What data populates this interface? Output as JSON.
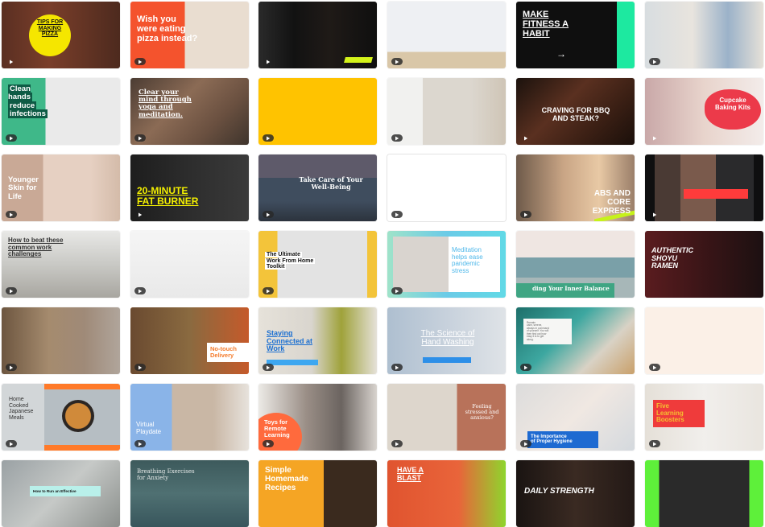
{
  "gallery": {
    "items": [
      {
        "id": "tips-pizza",
        "lines": "TIPS FOR\nMAKING\nPIZZA",
        "bg": "linear-gradient(90deg,#5a2f22,#7a3e2a 40%,#4d2a1e)",
        "accent": "#f5e600"
      },
      {
        "id": "wish-pizza",
        "lines": "Wish you\nwere eating\npizza instead?",
        "bg": "linear-gradient(90deg,#f4532d 0 46%,#e9ddd0 46%)",
        "accent": "#f4532d"
      },
      {
        "id": "gym-dark",
        "lines": "",
        "bg": "linear-gradient(90deg,#2a2a2a,#121212 30%,#1f1a17 60%,#0f0f0f)",
        "accent": "#d4f31a"
      },
      {
        "id": "yoga-lunge",
        "lines": "",
        "bg": "linear-gradient(180deg,#eef0f3 0 75%,#d9c7a8 75%)",
        "accent": "#7b8a99"
      },
      {
        "id": "fitness-habit",
        "lines": "MAKE\nFITNESS A\nHABIT",
        "bg": "linear-gradient(90deg,#0f0f0f 0 85%,#1de9a0 85%)",
        "accent": "#ffffff"
      },
      {
        "id": "woman-laptop",
        "lines": "",
        "bg": "linear-gradient(90deg,#d8dde0,#e8e4de 40%,#9bb2c9 70%,#e6e1d8)",
        "accent": "#6e8cab"
      },
      {
        "id": "clean-hands",
        "lines": "Clean hands\nreduce\ninfections",
        "bg": "linear-gradient(90deg,#3fb889 0 37%,#eaeaea 37%)",
        "accent": "#0e5b45"
      },
      {
        "id": "clear-mind",
        "lines": "Clear your\nmind through\nyoga and\nmeditation.",
        "bg": "linear-gradient(135deg,#4b3c33,#8b6b55 40%,#6a5040 70%,#3e342c)",
        "accent": "#5ec1c7"
      },
      {
        "id": "yellow-blank",
        "lines": "",
        "bg": "#ffc300",
        "accent": "#ffc300"
      },
      {
        "id": "meditation-room",
        "lines": "",
        "bg": "linear-gradient(90deg,#f1f1ef 0 30%,#dcd7cf 30% 70%,#cfc5b6)",
        "accent": "#3b3b3b"
      },
      {
        "id": "bbq-steak",
        "lines": "CRAVING FOR BBQ\nAND STEAK?",
        "bg": "linear-gradient(135deg,#1b120d,#5a3020 40%,#3a1f14 70%,#1a0f0a)",
        "accent": "#e2572b"
      },
      {
        "id": "cupcake-kits",
        "lines": "Cupcake\nBaking Kits",
        "bg": "linear-gradient(90deg,#c9a8a8,#e8d4cc 50%,#f3ecea)",
        "accent": "#ec3a4a"
      },
      {
        "id": "younger-skin",
        "lines": "Younger\nSkin for\nLife",
        "bg": "linear-gradient(90deg,#c9a996 0 35%,#e6d0c2 35% 75%,#d4bba9)",
        "accent": "#ffffff"
      },
      {
        "id": "fat-burner",
        "lines": "20-MINUTE\nFAT BURNER",
        "bg": "linear-gradient(90deg,#1d1d1d,#2d2d2d 50%,#3a3a3a)",
        "accent": "#f4f000"
      },
      {
        "id": "well-being",
        "lines": "Take Care of Your\nWell-Being",
        "bg": "linear-gradient(180deg,#5e5a6a 0 35%,#3f4d5e 35% 70%,#2c333d)",
        "accent": "#a89fd3"
      },
      {
        "id": "white-blank",
        "lines": "",
        "bg": "#ffffff",
        "accent": "#ffffff"
      },
      {
        "id": "abs-core",
        "lines": "ABS AND\nCORE\nEXPRESS",
        "bg": "linear-gradient(90deg,#6e5a4a,#c9a585 40%,#e8c9a5 70%,#9a7e69)",
        "accent": "#c6f21a"
      },
      {
        "id": "dark-red-bar",
        "lines": "",
        "bg": "linear-gradient(90deg,#0f0f10 0 8%,#4a3a34 8% 30%,#7a5a4c 30% 60%,#2a2a2c 60% 92%,#0f0f10 92%)",
        "accent": "#ff3b3b"
      },
      {
        "id": "work-challenges",
        "lines": "How to beat these\ncommon work\nchallenges",
        "bg": "linear-gradient(180deg,#e8e8e6,#c9c9c5 50%,#a8a6a0)",
        "accent": "#f7e234"
      },
      {
        "id": "happy-birthday-kids",
        "lines": "",
        "bg": "linear-gradient(180deg,#f5f5f5,#e9e9e9)",
        "accent": "#3b8df7"
      },
      {
        "id": "wfh-toolkit",
        "lines": "The Ultimate\nWork From Home\nToolkit",
        "bg": "linear-gradient(90deg,#f3c43a 0 16%,#e3e3e3 16% 92%,#f3c43a 92%)",
        "accent": "#f3c43a"
      },
      {
        "id": "meditation-stress",
        "lines": "Meditation\nhelps ease\npandemic\nstress",
        "bg": "linear-gradient(90deg,#9fe3c9,#6bcbe7 50%,#61d9e6)",
        "accent": "#4fb8ea"
      },
      {
        "id": "inner-balance",
        "lines": "ding Your Inner Balance",
        "bg": "linear-gradient(180deg,#efe6e2 0 40%,#7aa0a8 40% 70%,#a7b7b8 70%)",
        "accent": "#3fa583"
      },
      {
        "id": "shoyu-ramen",
        "lines": "AUTHENTIC\nSHOYU\nRAMEN",
        "bg": "linear-gradient(90deg,#5a1c1f,#3a1517 50%,#1c1011)",
        "accent": "#e23b3f"
      },
      {
        "id": "happy-birthday-girl",
        "lines": "",
        "bg": "linear-gradient(90deg,#6d5640,#a58b6e 40%,#9f8a78 70%,#b0a59b)",
        "accent": "#2fc6c4"
      },
      {
        "id": "no-touch-delivery",
        "lines": "No-touch\nDelivery",
        "bg": "linear-gradient(90deg,#6a4a30,#8a6a40 50%,#c55a2a)",
        "accent": "#f47a2a"
      },
      {
        "id": "staying-connected",
        "lines": "Staying\nConnected at\nWork",
        "bg": "linear-gradient(90deg,#e6e2da,#d9d5ce 45%,#9fa23a 70%,#e5e1d9)",
        "accent": "#1b6fd1"
      },
      {
        "id": "hand-washing",
        "lines": "The Science of\nHand Washing",
        "bg": "linear-gradient(90deg,#aebfd0,#c7d1dc 50%,#dfe3e7)",
        "accent": "#2d8fe8"
      },
      {
        "id": "remain-calm",
        "lines": "Remain\ncalm, serene,\nalways in command\nof yourself. You will\nthen find out how\neasy it is to get\nalong.",
        "bg": "linear-gradient(135deg,#1d6f6a,#3da7a0 40%,#d9d2c5 70%,#c9a06a)",
        "accent": "#ffffff"
      },
      {
        "id": "peach-blank",
        "lines": "",
        "bg": "#fbf0e7",
        "accent": "#fbf0e7"
      },
      {
        "id": "japanese-meals",
        "lines": "Home\nCooked\nJapanese\nMeals",
        "bg": "linear-gradient(90deg,#d2d6d8 0 36%,#b6bec3 36%)",
        "accent": "#ff7a29"
      },
      {
        "id": "virtual-playdate",
        "lines": "Virtual\nPlaydate",
        "bg": "linear-gradient(90deg,#8ab4e8 0 35%,#c9b7a5 35% 70%,#e7e2dc)",
        "accent": "#8ab4e8"
      },
      {
        "id": "toys-remote",
        "lines": "Toys for\nRemote\nLearning",
        "bg": "linear-gradient(90deg,#eceae6,#9b8f87 40%,#6b6460 70%,#d8d3ce)",
        "accent": "#ff6a3d"
      },
      {
        "id": "feeling-stressed",
        "lines": "Feeling\nstressed and\nanxious?",
        "bg": "linear-gradient(90deg,#ddd6cc 0 59%,#b8725a 59%)",
        "accent": "#b8725a"
      },
      {
        "id": "proper-hygiene",
        "lines": "The Importance\nof Proper Hygiene",
        "bg": "linear-gradient(135deg,#dcdcdc,#f0e8e2 50%,#d4d9de)",
        "accent": "#1e6ad1"
      },
      {
        "id": "learning-boosters",
        "lines": "Five\nLearning\nBoosters",
        "bg": "linear-gradient(90deg,#e5e0d8,#f1efec 50%,#e9e5df)",
        "accent": "#ef3b3b"
      },
      {
        "id": "effective-meeting",
        "lines": "How to Run an Effective",
        "bg": "linear-gradient(135deg,#9aa1a4,#c6c9c7 50%,#8b8f8c)",
        "accent": "#b9f0ea"
      },
      {
        "id": "breathing-anxiety",
        "lines": "Breathing Exercises\nfor Anxiety",
        "bg": "linear-gradient(180deg,#3d5a5c,#4f7072 50%,#38565c)",
        "accent": "#ffffff"
      },
      {
        "id": "homemade-recipes",
        "lines": "Simple\nHomemade\nRecipes",
        "bg": "linear-gradient(90deg,#f5a524 0 55%,#3a2a1e 55%)",
        "accent": "#f5a524"
      },
      {
        "id": "have-a-blast",
        "lines": "HAVE A\nBLAST",
        "bg": "linear-gradient(90deg,#e0542f,#e9643a 60%,#8fd52d)",
        "accent": "#8fd52d"
      },
      {
        "id": "daily-strength",
        "lines": "DAILY STRENGTH",
        "bg": "linear-gradient(90deg,#1a1412,#3a2a22 50%,#231916)",
        "accent": "#e55b1e"
      },
      {
        "id": "gym-green",
        "lines": "",
        "bg": "linear-gradient(90deg,#5ef03a 0 12%,#2a2a2a 12% 88%,#5ef03a 88%)",
        "accent": "#5ef03a"
      }
    ]
  }
}
